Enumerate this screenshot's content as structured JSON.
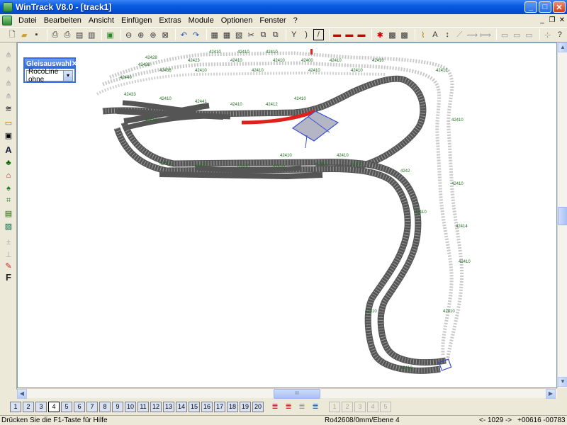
{
  "window": {
    "title": "WinTrack  V8.0 - [track1]"
  },
  "title_buttons": {
    "minimize": "_",
    "maximize": "□",
    "close": "✕"
  },
  "menu": [
    "Datei",
    "Bearbeiten",
    "Ansicht",
    "Einfügen",
    "Extras",
    "Module",
    "Optionen",
    "Fenster",
    "?"
  ],
  "mdi_buttons": {
    "minimize": "_",
    "restore": "❐",
    "close": "✕"
  },
  "panel": {
    "title": "Gleisauswahl",
    "close": "✕",
    "selected": "RocoLine ohne",
    "arrow": "▾"
  },
  "levels": [
    "1",
    "2",
    "3",
    "4",
    "5",
    "6",
    "7",
    "8",
    "9",
    "10",
    "11",
    "12",
    "13",
    "14",
    "15",
    "16",
    "17",
    "18",
    "19",
    "20"
  ],
  "levels_dim": [
    "1",
    "2",
    "3",
    "4",
    "5"
  ],
  "status": {
    "hint": "Drücken Sie die  F1-Taste für Hilfe",
    "track": "Ro42608/0mm/Ebene 4",
    "angle": "<- 1029 ->",
    "coords": "+00616  -00783"
  },
  "track_labels": [
    "42410",
    "42423",
    "42438",
    "42428",
    "42440",
    "42441",
    "42412",
    "42400",
    "4242",
    "42412",
    "42414",
    "42433"
  ],
  "scroll_glyphs": {
    "up": "▲",
    "down": "▼",
    "left": "◀",
    "right": "▶",
    "grip": "III"
  },
  "colors": {
    "title_blue": "#0a5ddf",
    "track_gray": "#8c8c8c",
    "label_green": "#1f6b1f",
    "selection_red": "#e0201a",
    "building_blue": "#3a4fd0"
  }
}
